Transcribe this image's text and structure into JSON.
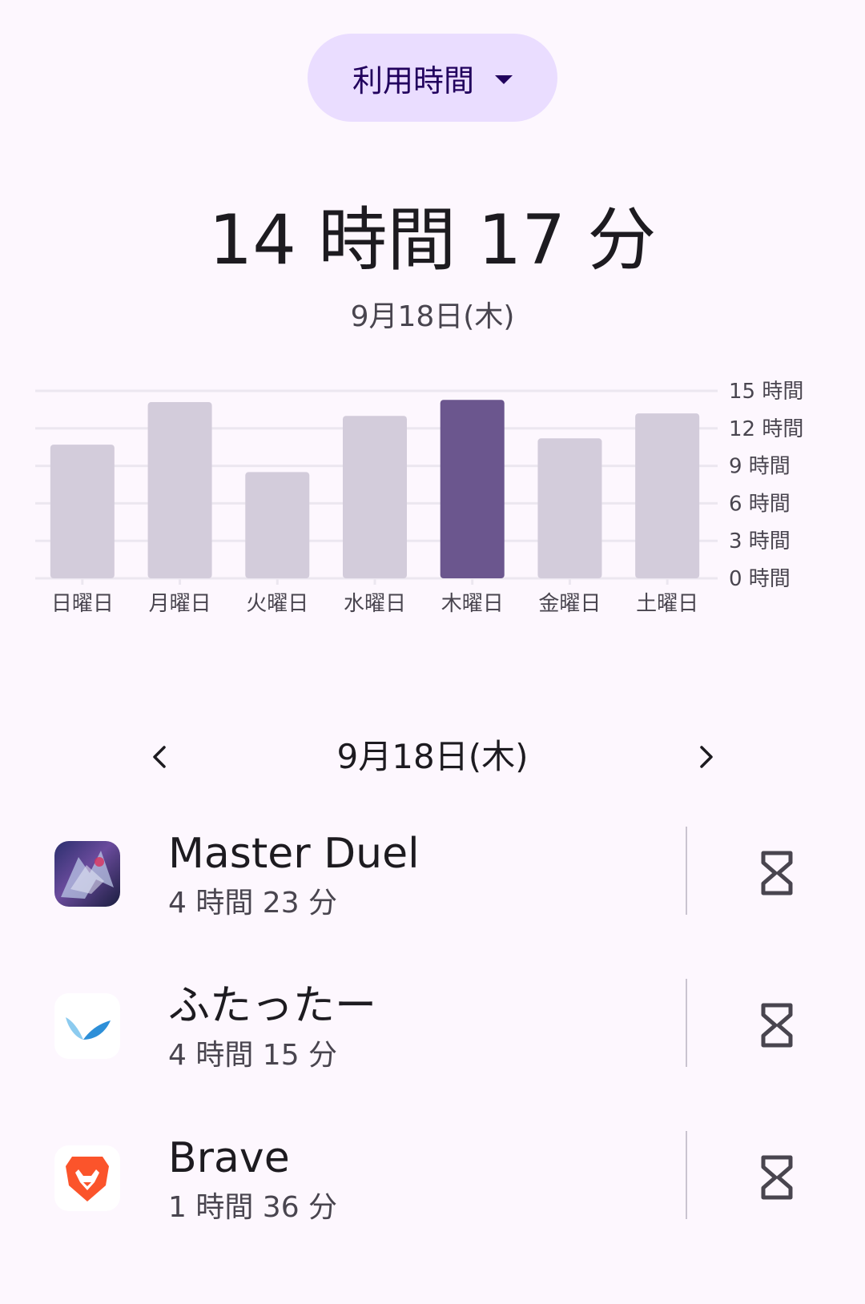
{
  "dropdown": {
    "label": "利用時間",
    "icon": "arrow-drop-down-icon"
  },
  "summary": {
    "total": "14 時間 17 分",
    "date": "9月18日(木)"
  },
  "chart_data": {
    "type": "bar",
    "categories": [
      "日曜日",
      "月曜日",
      "火曜日",
      "水曜日",
      "木曜日",
      "金曜日",
      "土曜日"
    ],
    "values": [
      10.7,
      14.1,
      8.5,
      13.0,
      14.28,
      11.2,
      13.2
    ],
    "unit": "時間",
    "ylim": [
      0,
      15
    ],
    "yticks": [
      0,
      3,
      6,
      9,
      12,
      15
    ],
    "ytick_labels": [
      "0 時間",
      "3 時間",
      "6 時間",
      "9 時間",
      "12 時間",
      "15 時間"
    ],
    "selected_index": 4,
    "grid": true,
    "y_axis_position": "right",
    "colors": {
      "bar": "#d3ccdb",
      "selected": "#6b568e",
      "grid": "#ece7f0",
      "tick_text": "#49454f"
    }
  },
  "date_nav": {
    "date": "9月18日(木)",
    "prev_icon": "chevron-left-icon",
    "next_icon": "chevron-right-icon"
  },
  "apps": [
    {
      "name": "Master Duel",
      "time": "4 時間 23 分",
      "icon": "master-duel-icon",
      "action_icon": "hourglass-icon"
    },
    {
      "name": "ふたったー",
      "time": "4 時間 15 分",
      "icon": "futatter-icon",
      "action_icon": "hourglass-icon"
    },
    {
      "name": "Brave",
      "time": "1 時間 36 分",
      "icon": "brave-lion-icon",
      "action_icon": "hourglass-icon"
    }
  ]
}
